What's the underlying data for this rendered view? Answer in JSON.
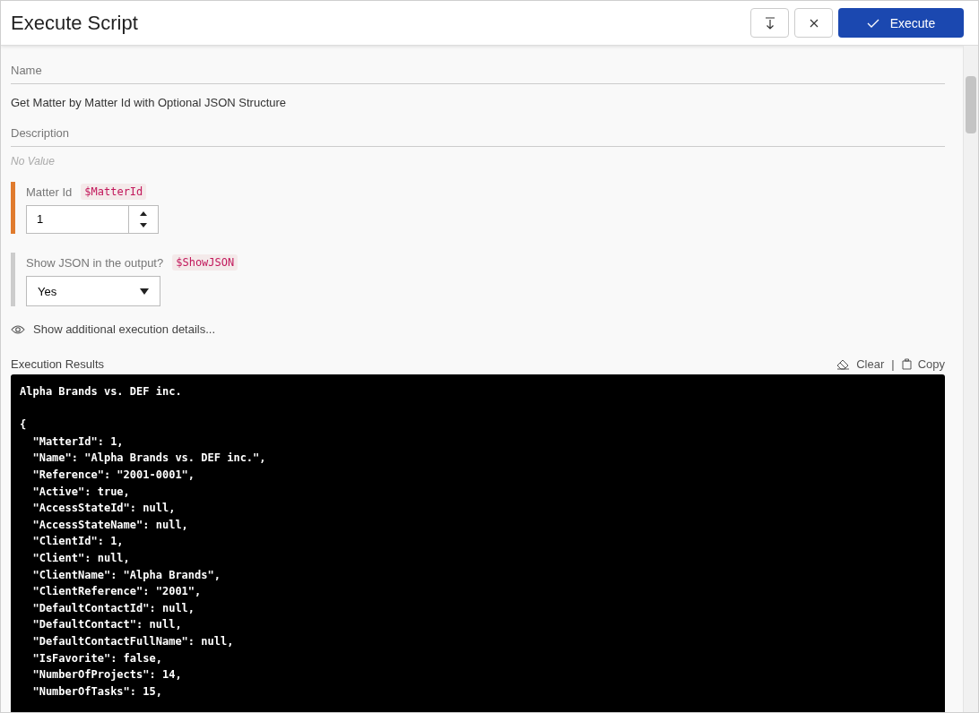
{
  "window": {
    "title": "Execute Script"
  },
  "toolbar": {
    "execute_label": "Execute"
  },
  "name_field": {
    "label": "Name",
    "value": "Get Matter by Matter Id with Optional JSON Structure"
  },
  "description_field": {
    "label": "Description",
    "value": "No Value"
  },
  "parameters": [
    {
      "kind": "number",
      "label": "Matter Id",
      "variable": "$MatterId",
      "value": "1",
      "color": "#e07b2e"
    },
    {
      "kind": "select",
      "label": "Show JSON in the output?",
      "variable": "$ShowJSON",
      "value": "Yes",
      "color": "#cccccc"
    }
  ],
  "details_link": "Show additional execution details...",
  "results": {
    "label": "Execution Results",
    "clear": "Clear",
    "separator": "|",
    "copy": "Copy",
    "heading": "Alpha Brands vs. DEF inc.",
    "lines": [
      "{",
      "  \"MatterId\": 1,",
      "  \"Name\": \"Alpha Brands vs. DEF inc.\",",
      "  \"Reference\": \"2001-0001\",",
      "  \"Active\": true,",
      "  \"AccessStateId\": null,",
      "  \"AccessStateName\": null,",
      "  \"ClientId\": 1,",
      "  \"Client\": null,",
      "  \"ClientName\": \"Alpha Brands\",",
      "  \"ClientReference\": \"2001\",",
      "  \"DefaultContactId\": null,",
      "  \"DefaultContact\": null,",
      "  \"DefaultContactFullName\": null,",
      "  \"IsFavorite\": false,",
      "  \"NumberOfProjects\": 14,",
      "  \"NumberOfTasks\": 15,"
    ]
  }
}
